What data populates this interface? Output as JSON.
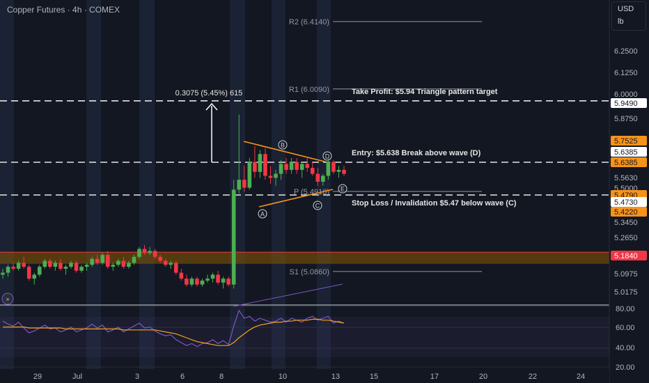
{
  "header": {
    "title": "Copper Futures · 4h · COMEX"
  },
  "unit": {
    "currency": "USD",
    "measure": "lb"
  },
  "colors": {
    "bull": "#4caf50",
    "bear": "#f23645",
    "orange": "#f7931a",
    "bg": "#131722",
    "grid": "#1e222d",
    "rsi": "#7e57c2",
    "rsi_ma": "#f7a21b",
    "sr_zone": "#8b5a00"
  },
  "chart_data": [
    {
      "type": "candlestick",
      "title": "Copper Futures · 4h · COMEX",
      "y_ticks": [
        "6.2500",
        "6.1250",
        "6.0000",
        "5.8750",
        "5.5630",
        "5.5000",
        "5.3450",
        "5.2650",
        "5.0975",
        "5.0175"
      ],
      "x_ticks": [
        "29",
        "Jul",
        "3",
        "6",
        "8",
        "10",
        "13",
        "15",
        "17",
        "20",
        "22",
        "24"
      ],
      "price_labels": [
        {
          "value": "5.9490",
          "style": "white"
        },
        {
          "value": "5.7525",
          "style": "orange"
        },
        {
          "value": "5.6385",
          "style": "white"
        },
        {
          "value": "5.6385",
          "style": "orange"
        },
        {
          "value": "5.4790",
          "style": "orange"
        },
        {
          "value": "5.4730",
          "style": "white"
        },
        {
          "value": "5.4220",
          "style": "orange"
        },
        {
          "value": "5.1840",
          "style": "red"
        }
      ],
      "pivots": [
        {
          "label": "R2 (6.4140)",
          "value": 6.414
        },
        {
          "label": "R1 (6.0090)",
          "value": 6.009
        },
        {
          "label": "P (5.4910)",
          "value": 5.491
        },
        {
          "label": "S1 (5.0860)",
          "value": 5.086
        }
      ],
      "levels": [
        {
          "name": "take-profit",
          "value": 5.949,
          "label": "Take Profit: $5.94 Triangle pattern target"
        },
        {
          "name": "entry",
          "value": 5.6385,
          "label": "Entry: $5.638 Break above wave (D)"
        },
        {
          "name": "stop-loss",
          "value": 5.473,
          "label": "Stop Loss / Invalidation $5.47 below wave (C)"
        }
      ],
      "measure_label": "0.3075 (5.45%) 615",
      "wave_labels": [
        "A",
        "B",
        "C",
        "D",
        "E"
      ],
      "sr_zone": {
        "top": 5.184,
        "bottom": 5.125
      },
      "candles": [
        [
          5.07,
          5.1,
          5.05,
          5.08
        ],
        [
          5.08,
          5.12,
          5.06,
          5.11
        ],
        [
          5.11,
          5.13,
          5.09,
          5.1
        ],
        [
          5.1,
          5.14,
          5.09,
          5.13
        ],
        [
          5.13,
          5.16,
          5.1,
          5.11
        ],
        [
          5.11,
          5.12,
          5.04,
          5.05
        ],
        [
          5.05,
          5.08,
          5.02,
          5.07
        ],
        [
          5.07,
          5.12,
          5.06,
          5.11
        ],
        [
          5.11,
          5.15,
          5.1,
          5.14
        ],
        [
          5.14,
          5.15,
          5.1,
          5.11
        ],
        [
          5.11,
          5.14,
          5.09,
          5.13
        ],
        [
          5.13,
          5.15,
          5.09,
          5.1
        ],
        [
          5.1,
          5.12,
          5.07,
          5.11
        ],
        [
          5.11,
          5.14,
          5.1,
          5.13
        ],
        [
          5.13,
          5.14,
          5.08,
          5.09
        ],
        [
          5.09,
          5.12,
          5.08,
          5.11
        ],
        [
          5.11,
          5.13,
          5.09,
          5.12
        ],
        [
          5.12,
          5.16,
          5.11,
          5.15
        ],
        [
          5.15,
          5.17,
          5.12,
          5.13
        ],
        [
          5.13,
          5.18,
          5.12,
          5.17
        ],
        [
          5.17,
          5.19,
          5.1,
          5.11
        ],
        [
          5.11,
          5.13,
          5.09,
          5.12
        ],
        [
          5.12,
          5.15,
          5.11,
          5.14
        ],
        [
          5.14,
          5.16,
          5.1,
          5.11
        ],
        [
          5.11,
          5.14,
          5.1,
          5.13
        ],
        [
          5.13,
          5.17,
          5.12,
          5.16
        ],
        [
          5.16,
          5.21,
          5.15,
          5.2
        ],
        [
          5.2,
          5.22,
          5.17,
          5.18
        ],
        [
          5.18,
          5.21,
          5.17,
          5.19
        ],
        [
          5.19,
          5.2,
          5.15,
          5.16
        ],
        [
          5.16,
          5.17,
          5.13,
          5.14
        ],
        [
          5.14,
          5.15,
          5.11,
          5.12
        ],
        [
          5.12,
          5.14,
          5.1,
          5.13
        ],
        [
          5.13,
          5.14,
          5.07,
          5.08
        ],
        [
          5.08,
          5.1,
          5.04,
          5.05
        ],
        [
          5.05,
          5.07,
          5.01,
          5.02
        ],
        [
          5.02,
          5.06,
          5.01,
          5.05
        ],
        [
          5.05,
          5.06,
          5.01,
          5.02
        ],
        [
          5.02,
          5.05,
          5.01,
          5.04
        ],
        [
          5.04,
          5.07,
          5.03,
          5.05
        ],
        [
          5.05,
          5.08,
          5.03,
          5.07
        ],
        [
          5.07,
          5.09,
          5.02,
          5.03
        ],
        [
          5.03,
          5.06,
          5.0,
          5.05
        ],
        [
          5.05,
          5.06,
          5.01,
          5.02
        ],
        [
          5.02,
          5.55,
          5.0,
          5.5
        ],
        [
          5.5,
          5.88,
          5.48,
          5.55
        ],
        [
          5.55,
          5.62,
          5.49,
          5.51
        ],
        [
          5.51,
          5.66,
          5.5,
          5.64
        ],
        [
          5.64,
          5.72,
          5.56,
          5.59
        ],
        [
          5.59,
          5.7,
          5.56,
          5.68
        ],
        [
          5.68,
          5.71,
          5.55,
          5.57
        ],
        [
          5.57,
          5.62,
          5.53,
          5.56
        ],
        [
          5.56,
          5.6,
          5.52,
          5.58
        ],
        [
          5.58,
          5.65,
          5.55,
          5.63
        ],
        [
          5.63,
          5.66,
          5.58,
          5.6
        ],
        [
          5.6,
          5.66,
          5.58,
          5.64
        ],
        [
          5.64,
          5.66,
          5.58,
          5.6
        ],
        [
          5.6,
          5.64,
          5.56,
          5.63
        ],
        [
          5.63,
          5.66,
          5.59,
          5.61
        ],
        [
          5.61,
          5.64,
          5.57,
          5.58
        ],
        [
          5.58,
          5.61,
          5.52,
          5.54
        ],
        [
          5.54,
          5.58,
          5.52,
          5.57
        ],
        [
          5.57,
          5.66,
          5.55,
          5.64
        ],
        [
          5.64,
          5.65,
          5.58,
          5.59
        ],
        [
          5.59,
          5.62,
          5.56,
          5.6
        ],
        [
          5.6,
          5.62,
          5.57,
          5.58
        ]
      ]
    },
    {
      "type": "line",
      "name": "RSI",
      "y_ticks": [
        "80.00",
        "60.00",
        "40.00",
        "20.00"
      ],
      "ylim": [
        13,
        87
      ],
      "series": [
        {
          "role": "rsi",
          "values": [
            67,
            64,
            62,
            66,
            60,
            55,
            57,
            60,
            63,
            59,
            60,
            56,
            58,
            61,
            56,
            58,
            60,
            64,
            60,
            63,
            56,
            58,
            61,
            56,
            59,
            62,
            65,
            60,
            61,
            57,
            54,
            52,
            53,
            48,
            45,
            42,
            44,
            41,
            44,
            45,
            48,
            44,
            47,
            43,
            62,
            78,
            70,
            72,
            67,
            70,
            68,
            66,
            67,
            70,
            66,
            70,
            68,
            66,
            70,
            72,
            68,
            70,
            72,
            65,
            67,
            65
          ]
        },
        {
          "role": "ma",
          "values": [
            61,
            61,
            61,
            61,
            61,
            60,
            60,
            60,
            60,
            60,
            60,
            60,
            59,
            59,
            59,
            59,
            59,
            59,
            59,
            59,
            59,
            59,
            59,
            58,
            58,
            58,
            58,
            58,
            58,
            58,
            57,
            56,
            55,
            54,
            52,
            50,
            48,
            46,
            45,
            44,
            43,
            42,
            42,
            42,
            45,
            50,
            54,
            58,
            61,
            63,
            64,
            65,
            66,
            66,
            67,
            67,
            68,
            68,
            68,
            69,
            69,
            68,
            68,
            67,
            66,
            65
          ]
        }
      ]
    }
  ]
}
